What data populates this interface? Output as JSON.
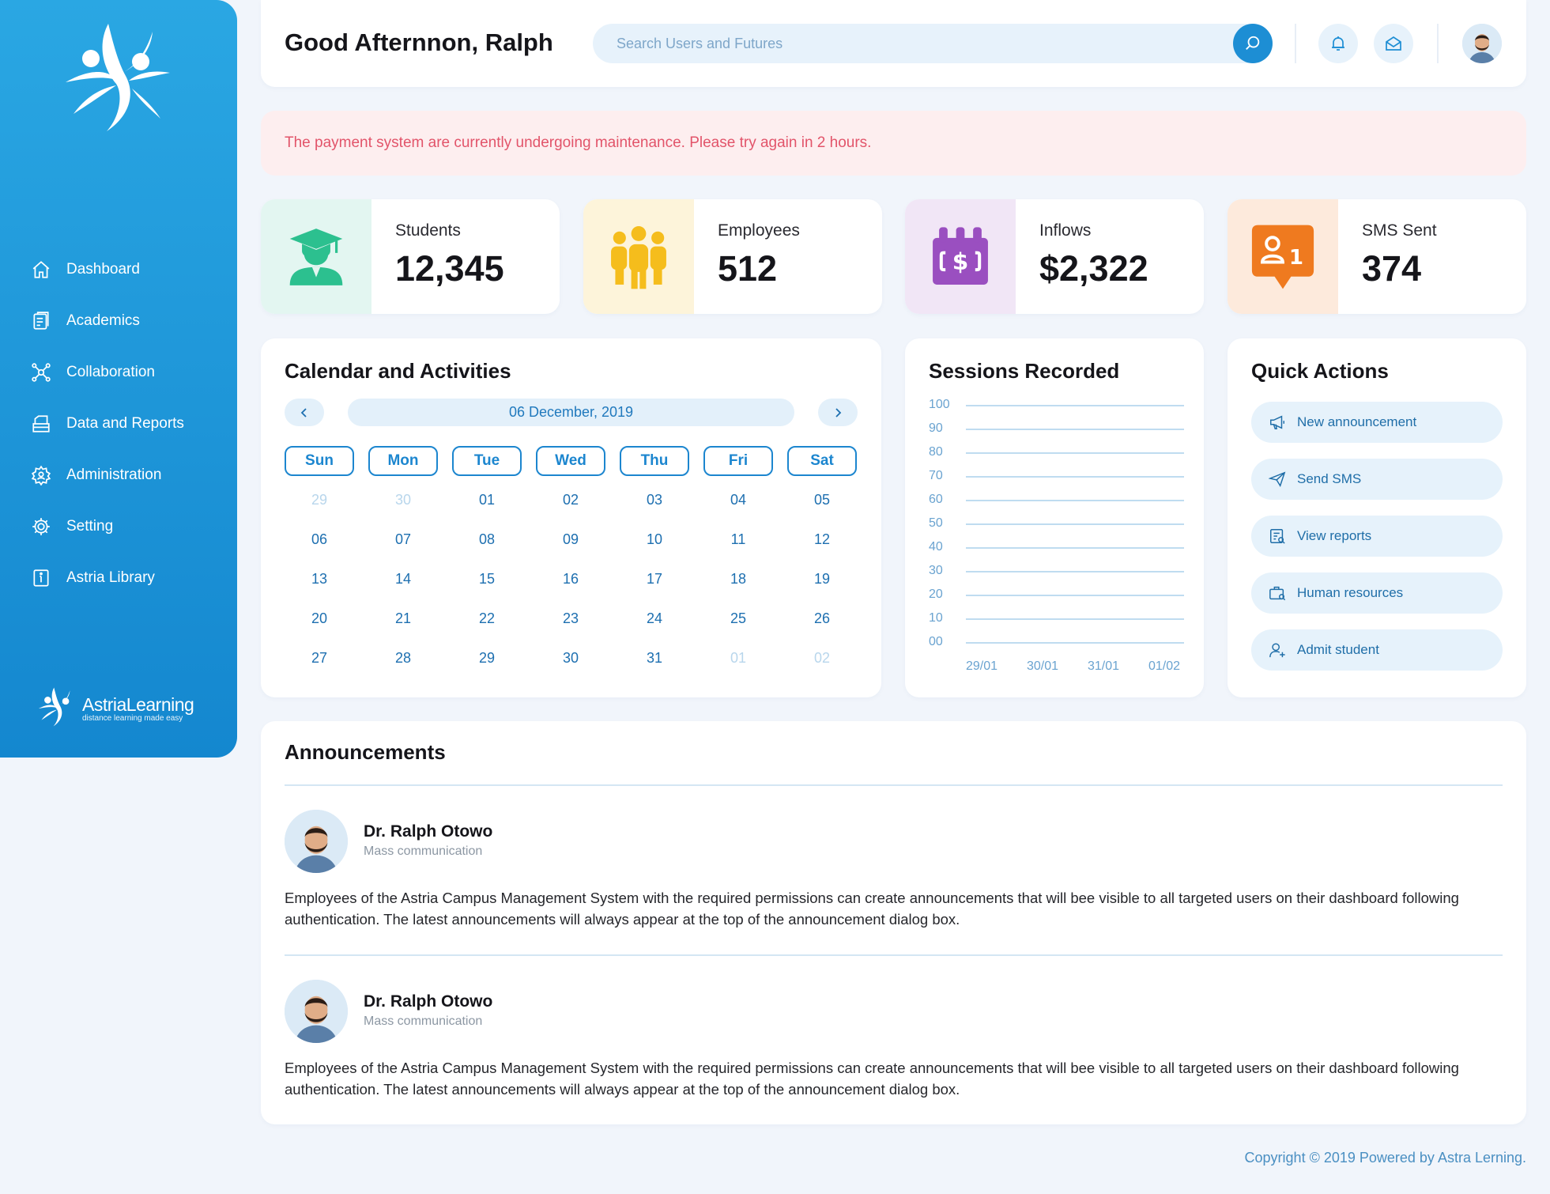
{
  "header": {
    "greeting": "Good Afternnon, Ralph",
    "search_placeholder": "Search Users and Futures"
  },
  "sidebar": {
    "items": [
      {
        "label": "Dashboard",
        "icon": "home-icon"
      },
      {
        "label": "Academics",
        "icon": "academics-icon"
      },
      {
        "label": "Collaboration",
        "icon": "collaboration-icon"
      },
      {
        "label": "Data and Reports",
        "icon": "reports-icon"
      },
      {
        "label": "Administration",
        "icon": "administration-icon"
      },
      {
        "label": "Setting",
        "icon": "gear-icon"
      },
      {
        "label": "Astria Library",
        "icon": "library-icon"
      }
    ],
    "brand": {
      "name": "AstriaLearning",
      "tagline": "distance learning made easy"
    }
  },
  "alert": {
    "message": "The payment system are currently undergoing maintenance. Please try again in 2 hours."
  },
  "stats": [
    {
      "label": "Students",
      "value": "12,345",
      "icon": "graduate-icon",
      "bg": "#e3f6f1",
      "color": "#2cc08f"
    },
    {
      "label": "Employees",
      "value": "512",
      "icon": "group-icon",
      "bg": "#fdf4da",
      "color": "#f5bd1c"
    },
    {
      "label": "Inflows",
      "value": "$2,322",
      "icon": "money-icon",
      "bg": "#f1e6f6",
      "color": "#9a4fc0"
    },
    {
      "label": "SMS Sent",
      "value": "374",
      "icon": "sms-notification-icon",
      "bg": "#fdeadc",
      "color": "#ef7a1f",
      "badge": "1"
    }
  ],
  "calendar": {
    "title": "Calendar and Activities",
    "month_label": "06 December, 2019",
    "weekdays": [
      "Sun",
      "Mon",
      "Tue",
      "Wed",
      "Thu",
      "Fri",
      "Sat"
    ],
    "weeks": [
      [
        {
          "d": "29",
          "m": true
        },
        {
          "d": "30",
          "m": true
        },
        {
          "d": "01"
        },
        {
          "d": "02"
        },
        {
          "d": "03"
        },
        {
          "d": "04"
        },
        {
          "d": "05"
        }
      ],
      [
        {
          "d": "06"
        },
        {
          "d": "07"
        },
        {
          "d": "08"
        },
        {
          "d": "09"
        },
        {
          "d": "10"
        },
        {
          "d": "11"
        },
        {
          "d": "12"
        }
      ],
      [
        {
          "d": "13"
        },
        {
          "d": "14"
        },
        {
          "d": "15"
        },
        {
          "d": "16"
        },
        {
          "d": "17"
        },
        {
          "d": "18"
        },
        {
          "d": "19"
        }
      ],
      [
        {
          "d": "20"
        },
        {
          "d": "21"
        },
        {
          "d": "22"
        },
        {
          "d": "23"
        },
        {
          "d": "24"
        },
        {
          "d": "25"
        },
        {
          "d": "26"
        }
      ],
      [
        {
          "d": "27"
        },
        {
          "d": "28"
        },
        {
          "d": "29"
        },
        {
          "d": "30"
        },
        {
          "d": "31"
        },
        {
          "d": "01",
          "m": true
        },
        {
          "d": "02",
          "m": true
        }
      ]
    ]
  },
  "sessions": {
    "title": "Sessions Recorded",
    "y_ticks": [
      "100",
      "90",
      "80",
      "70",
      "60",
      "50",
      "40",
      "30",
      "20",
      "10",
      "00"
    ],
    "x_ticks": [
      "29/01",
      "30/01",
      "31/01",
      "01/02"
    ]
  },
  "quick_actions": {
    "title": "Quick Actions",
    "items": [
      {
        "label": "New announcement",
        "icon": "megaphone-icon"
      },
      {
        "label": "Send SMS",
        "icon": "send-icon"
      },
      {
        "label": "View reports",
        "icon": "report-icon"
      },
      {
        "label": "Human resources",
        "icon": "briefcase-icon"
      },
      {
        "label": "Admit student",
        "icon": "add-user-icon"
      }
    ]
  },
  "announcements": {
    "title": "Announcements",
    "items": [
      {
        "author": "Dr. Ralph Otowo",
        "role": "Mass communication",
        "body": "Employees of the Astria Campus Management System with the required permissions can create announcements that will bee visible to all targeted users on their dashboard following authentication. The latest announcements will always appear at the top of the announcement dialog box."
      },
      {
        "author": "Dr. Ralph Otowo",
        "role": "Mass communication",
        "body": "Employees of the Astria Campus Management System with the required permissions can create announcements that will bee visible to all targeted users on their dashboard following authentication. The latest announcements will always appear at the top of the announcement dialog box."
      }
    ]
  },
  "footer": {
    "copyright": "Copyright © 2019 Powered by Astra Lerning."
  },
  "colors": {
    "accent": "#1d8ed4",
    "sidebar": "#1a95d9",
    "alert_text": "#e2546a"
  }
}
